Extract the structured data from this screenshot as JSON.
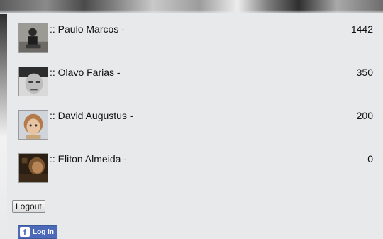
{
  "leaderboard": [
    {
      "name": ":: Paulo Marcos -",
      "score": "1442",
      "avatar": "avatar-photo"
    },
    {
      "name": ":: Olavo Farias -",
      "score": "350",
      "avatar": "avatar-photo"
    },
    {
      "name": ":: David Augustus -",
      "score": "200",
      "avatar": "avatar-photo"
    },
    {
      "name": ":: Eliton Almeida -",
      "score": "0",
      "avatar": "avatar-photo"
    }
  ],
  "actions": {
    "logout_label": "Logout",
    "facebook_login_label": "Log In",
    "facebook_icon": "f"
  },
  "colors": {
    "facebook_blue": "#4c69ba",
    "background": "#e8e9eb"
  }
}
